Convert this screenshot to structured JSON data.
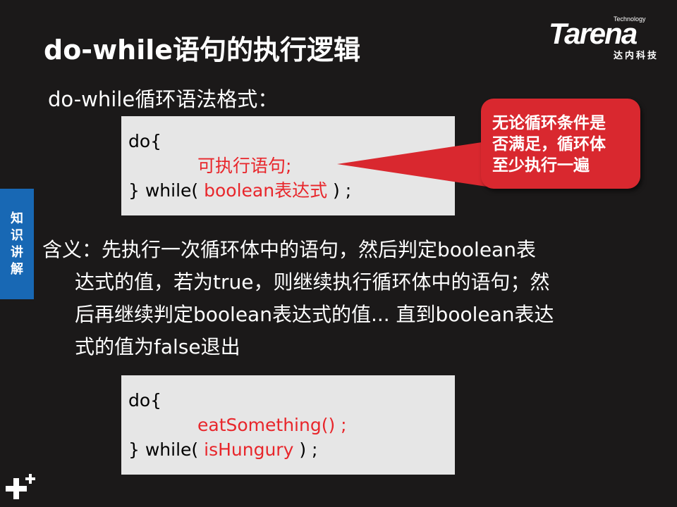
{
  "slide": {
    "title": "do-while语句的执行逻辑",
    "syntax_heading": "do-while循环语法格式：",
    "side_tab": [
      "知",
      "识",
      "讲",
      "解"
    ]
  },
  "logo": {
    "small": "Technology",
    "main": "Tarena",
    "sub": "达内科技"
  },
  "code_block_1": {
    "line1": "do{",
    "line2": "可执行语句;",
    "line3_prefix": "} while( ",
    "line3_condition": "boolean表达式",
    "line3_suffix": " ) ;"
  },
  "callout": {
    "text": "无论循环条件是\n否满足，循环体\n至少执行一遍"
  },
  "meaning": {
    "line1": "含义：先执行一次循环体中的语句，然后判定boolean表",
    "line2": "达式的值，若为true，则继续执行循环体中的语句；然",
    "line3": "后再继续判定boolean表达式的值... 直到boolean表达",
    "line4": "式的值为false退出"
  },
  "code_block_2": {
    "line1": "do{",
    "line2": "eatSomething() ;",
    "line3_prefix": "} while( ",
    "line3_condition": "isHungury",
    "line3_suffix": " ) ;"
  },
  "colors": {
    "background": "#1b1919",
    "code_box": "#e6e6e6",
    "highlight_red": "#e8262b",
    "callout_red": "#d9282f",
    "side_tab_blue": "#1868b4"
  },
  "icons": {
    "bottom_left": "plus-icon"
  }
}
